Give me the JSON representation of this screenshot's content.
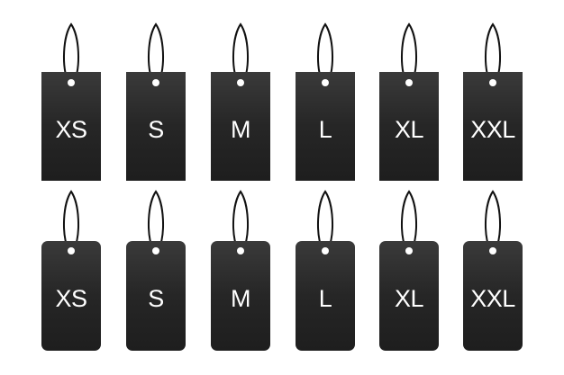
{
  "tag_color": "#2b2b2b",
  "string_color": "#111111",
  "label_color": "#ffffff",
  "rows": [
    {
      "style": "rectangular",
      "tags": [
        {
          "label": "XS"
        },
        {
          "label": "S"
        },
        {
          "label": "M"
        },
        {
          "label": "L"
        },
        {
          "label": "XL"
        },
        {
          "label": "XXL"
        }
      ]
    },
    {
      "style": "rounded",
      "tags": [
        {
          "label": "XS"
        },
        {
          "label": "S"
        },
        {
          "label": "M"
        },
        {
          "label": "L"
        },
        {
          "label": "XL"
        },
        {
          "label": "XXL"
        }
      ]
    }
  ]
}
